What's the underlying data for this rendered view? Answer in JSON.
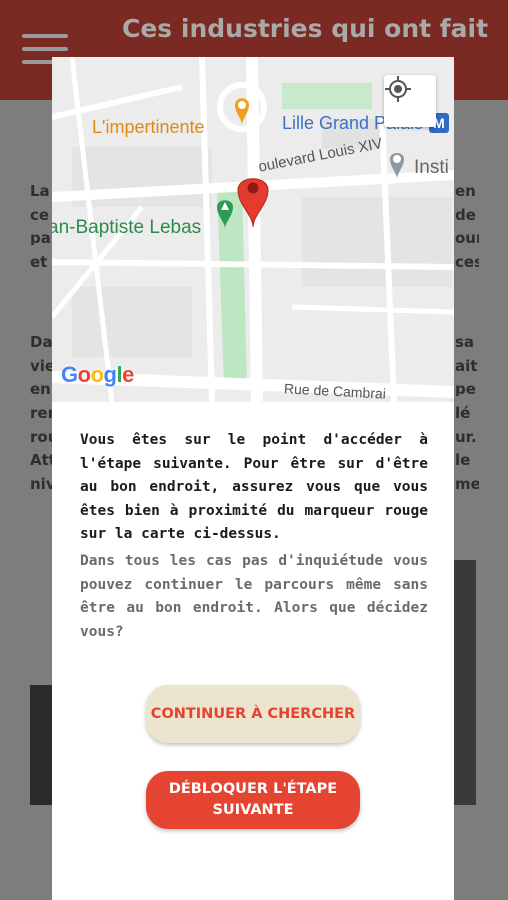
{
  "app_header": {
    "title": "Ces industries qui ont fait",
    "menu_icon": "hamburger-menu-icon"
  },
  "background_text": {
    "left_fragments": [
      "La",
      "ce",
      "pa",
      "et",
      "Da",
      "vie",
      "en",
      "ren",
      "rou",
      "Att",
      "niv"
    ],
    "right_fragments": [
      "en",
      "de",
      "our",
      "ces",
      "sa",
      "ait",
      "pe",
      "lé",
      "ur.",
      "le",
      "me"
    ]
  },
  "map": {
    "labels": {
      "restaurant": "L'impertinente",
      "palais": "Lille Grand Palais",
      "metro": "M",
      "boulevard": "oulevard Louis XIV",
      "insti": "Insti",
      "park": "an-Baptiste Lebas",
      "street": "Rue de Cambrai"
    },
    "google_logo": [
      "G",
      "o",
      "o",
      "g",
      "l",
      "e"
    ],
    "colors": {
      "marker": "#e53a2f",
      "restaurant_pin": "#f0a01e",
      "park_pin": "#2f9a55",
      "park_fill": "#bde6c2",
      "metro": "#2f6ac4"
    },
    "icons": {
      "locate": "my-location-icon",
      "marker": "red-map-marker-icon"
    }
  },
  "dialog": {
    "message_primary": "Vous êtes sur le point d'accéder à l'étape suivante. Pour être sur d'être au bon endroit, assurez vous que vous êtes bien à proximité du marqueur rouge sur la carte ci-dessus.",
    "message_secondary": "Dans tous les cas pas d'inquiétude vous pouvez continuer le parcours même sans être au bon endroit. Alors que décidez vous?",
    "continue_label": "CONTINUER À CHERCHER",
    "unlock_label": "DÉBLOQUER L'ÉTAPE SUIVANTE"
  },
  "colors": {
    "header": "#7a2a22",
    "accent": "#e54431",
    "continue_bg": "#ece4cf"
  }
}
